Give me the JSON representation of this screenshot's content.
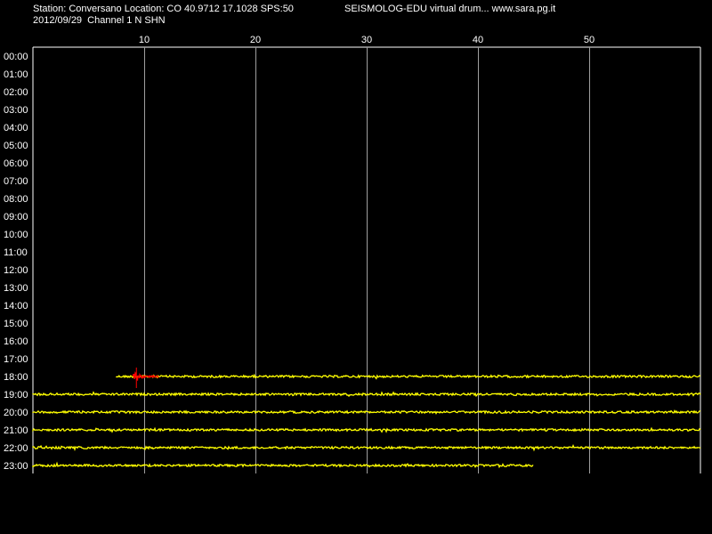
{
  "header": {
    "station_line": "Station: Conversano Location: CO 40.9712 17.1028 SPS:50",
    "brand_line": "SEISMOLOG-EDU virtual drum... www.sara.pg.it",
    "date_line": "2012/09/29  Channel 1 N SHN"
  },
  "colors": {
    "background": "#000000",
    "frame": "#ffffff",
    "grid": "#a0a0a0",
    "trace": "#ffff00",
    "event": "#ff0000",
    "text": "#ffffff"
  },
  "chart_data": {
    "type": "line",
    "title": "",
    "xlabel": "",
    "ylabel": "",
    "xlim": [
      0,
      60
    ],
    "x_ticks": [
      10,
      20,
      30,
      40,
      50
    ],
    "x_tick_labels": [
      "10",
      "20",
      "30",
      "40",
      "50"
    ],
    "grid": "vertical",
    "rows": [
      "00:00",
      "01:00",
      "02:00",
      "03:00",
      "04:00",
      "05:00",
      "06:00",
      "07:00",
      "08:00",
      "09:00",
      "10:00",
      "11:00",
      "12:00",
      "13:00",
      "14:00",
      "15:00",
      "16:00",
      "17:00",
      "18:00",
      "19:00",
      "20:00",
      "21:00",
      "22:00",
      "23:00"
    ],
    "series": [
      {
        "row": "18:00",
        "x_start": 7.5,
        "x_end": 60
      },
      {
        "row": "19:00",
        "x_start": 0,
        "x_end": 60
      },
      {
        "row": "20:00",
        "x_start": 0,
        "x_end": 60
      },
      {
        "row": "21:00",
        "x_start": 0,
        "x_end": 60
      },
      {
        "row": "22:00",
        "x_start": 0,
        "x_end": 60
      },
      {
        "row": "23:00",
        "x_start": 0,
        "x_end": 45
      }
    ],
    "events": [
      {
        "row": "18:00",
        "x_start": 9.0,
        "x_end": 11.3,
        "peak_x": 9.3
      }
    ]
  }
}
